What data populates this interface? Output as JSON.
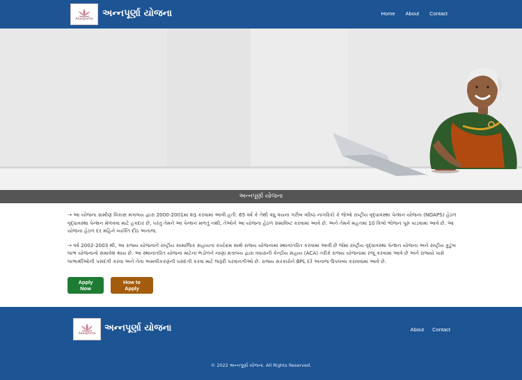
{
  "navbar": {
    "logo_text": "Annapurna",
    "brand": "અન્નપૂર્ણા યોજના",
    "links": [
      "Home",
      "About",
      "Contact"
    ]
  },
  "hero": {
    "caption": "અન્નપૂર્ણા યોજના"
  },
  "content": {
    "paragraphs": [
      "→ આ યોજના ગ્રામીણ વિકાસ મંત્રાલય દ્વારા 2000-2001માં શરૂ કરવામાં આવી હતી. 65 વર્ષ કે તેથી વધુ વયના ગરીબ વરિષ્ઠ નાગરિકો કે જેઓ રાષ્ટ્રીય વૃદ્ધાવસ્થા પેન્શન યોજના (NOAPS) હેઠળ વૃદ્ધાવસ્થા પેન્શન મેળવવા માટે હકદાર છે, પરંતુ તેમને આ પેન્શન મળતું નથી, તેઓને આ યોજના હેઠળ સમાવિષ્ટ કરવામાં આવે છે. અને તેમને મહતમાં 10 કિલો ભોજન પૂરું પાડવામાં આવે છે. આ યોજના હેઠળ દર મહિને વ્યક્તિ દીઠ અનાજ.",
      "→ વર્ષ 2002-2003 થી, આ રાજ્ય યોજનાને રાષ્ટ્રીય સામાજિક સહાયતા કાર્યક્રમ સાથે રાજ્ય યોજનામાં સ્થાનાંતરિત કરવામાં આવી છે જેમાં રાષ્ટ્રીય વૃદ્ધાવસ્થા પેન્શન યોજના અને રાષ્ટ્રીય કુટુંબ લાભ યોજનાનો સમાવેશ થાય છે. આ સ્થાનાંતરિત યોજના માટેના ભંડોળને નાણાં મંત્રાલય દ્વારા વધારાની કેન્દ્રીય સહાય (ACA) તરીકે રાજ્ય યોજનામાં રજૂ કરવામાં આવે છે અને રાજ્યો પાસે લાભાર્થીઓની પસંદગી કરવા અને તેના અમલીકરણની પસંદગી કરવા માટે જરૂરી પરવાનગીઓ છે. રાજ્ય સરકારોને BPL દરે અનાજ ઉપલબ્ધ કરાવવામાં આવે છે."
    ],
    "buttons": {
      "apply": "Apply Now",
      "how": "How to Apply"
    }
  },
  "footer": {
    "logo_text": "Annapurna",
    "brand": "અન્નપૂર્ણા યોજના",
    "links": [
      "About",
      "Contact"
    ],
    "copyright": "© 2022 અન્નપૂર્ણા યોજના. All Rights Reserved."
  },
  "colors": {
    "primary": "#1c5494",
    "apply_button": "#1e7b33",
    "how_button": "#a35c0c",
    "caption_bar": "#555555"
  }
}
